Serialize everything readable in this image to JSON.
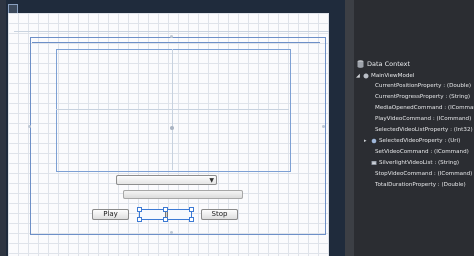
{
  "designer": {
    "play_label": "Play",
    "stop_label": "Stop",
    "combo_arrow": "▼"
  },
  "data_context": {
    "header": "Data Context",
    "root": "MainViewModel",
    "items": [
      {
        "label": "CurrentPositionProperty : (Double)",
        "icon": "property-icon"
      },
      {
        "label": "CurrentProgressProperty : (String)",
        "icon": "property-icon"
      },
      {
        "label": "MediaOpenedCommand : (ICommand)",
        "icon": "command-icon"
      },
      {
        "label": "PlayVideoCommand : (ICommand)",
        "icon": "command-icon"
      },
      {
        "label": "SelectedVideoListProperty : (Int32)",
        "icon": "property-icon"
      },
      {
        "label": "SelectedVideoProperty : (Uri)",
        "icon": "object-icon"
      },
      {
        "label": "SetVideoCommand : (ICommand)",
        "icon": "command-icon"
      },
      {
        "label": "SilverlightVideoList : (String)",
        "icon": "collection-icon"
      },
      {
        "label": "StopVideoCommand : (ICommand)",
        "icon": "command-icon"
      },
      {
        "label": "TotalDurationProperty : (Double)",
        "icon": "property-icon"
      }
    ]
  },
  "colors": {
    "designer_bg": "#1f2b3c",
    "panel_bg": "#2b2d32",
    "selection_blue": "#3d7ad4"
  }
}
